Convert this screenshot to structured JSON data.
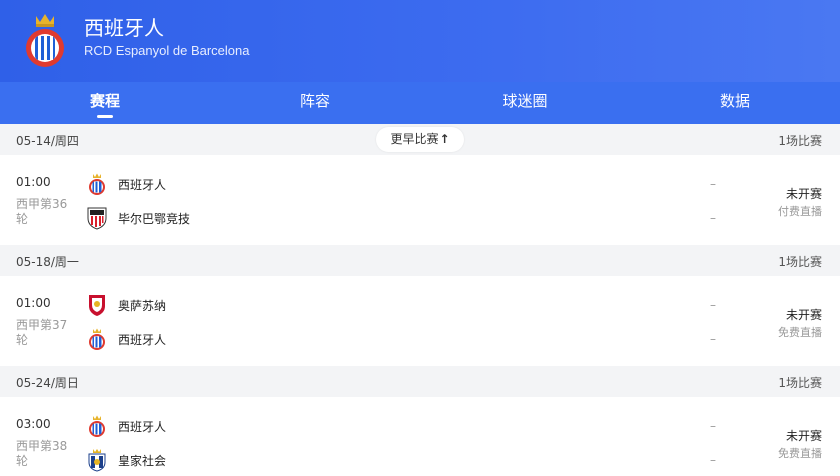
{
  "team": {
    "name_zh": "西班牙人",
    "name_en": "RCD Espanyol de Barcelona",
    "crest_text": "R.C.D. ESPANYOL BARCELONA"
  },
  "tabs": [
    {
      "label": "赛程",
      "active": true
    },
    {
      "label": "阵容",
      "active": false
    },
    {
      "label": "球迷圈",
      "active": false
    },
    {
      "label": "数据",
      "active": false
    }
  ],
  "earlier_button": {
    "label": "更早比赛",
    "arrow": "🡑"
  },
  "days": [
    {
      "date": "05-14/周四",
      "count": "1场比赛",
      "match": {
        "time": "01:00",
        "round": "西甲第36轮",
        "home": {
          "name": "西班牙人",
          "logo": "espanyol-logo"
        },
        "away": {
          "name": "毕尔巴鄂竞技",
          "logo": "athletic-bilbao-logo"
        },
        "home_score": "–",
        "away_score": "–",
        "status": "未开赛",
        "stream": "付费直播"
      }
    },
    {
      "date": "05-18/周一",
      "count": "1场比赛",
      "match": {
        "time": "01:00",
        "round": "西甲第37轮",
        "home": {
          "name": "奥萨苏纳",
          "logo": "osasuna-logo"
        },
        "away": {
          "name": "西班牙人",
          "logo": "espanyol-logo"
        },
        "home_score": "–",
        "away_score": "–",
        "status": "未开赛",
        "stream": "免费直播"
      }
    },
    {
      "date": "05-24/周日",
      "count": "1场比赛",
      "match": {
        "time": "03:00",
        "round": "西甲第38轮",
        "home": {
          "name": "西班牙人",
          "logo": "espanyol-logo"
        },
        "away": {
          "name": "皇家社会",
          "logo": "real-sociedad-logo"
        },
        "home_score": "–",
        "away_score": "–",
        "status": "未开赛",
        "stream": "免费直播"
      }
    }
  ],
  "colors": {
    "header_blue": "#3a6ff0",
    "espanyol_blue": "#1f5fd6",
    "crest_red": "#e03a2f",
    "crest_gold": "#e7b32b"
  }
}
